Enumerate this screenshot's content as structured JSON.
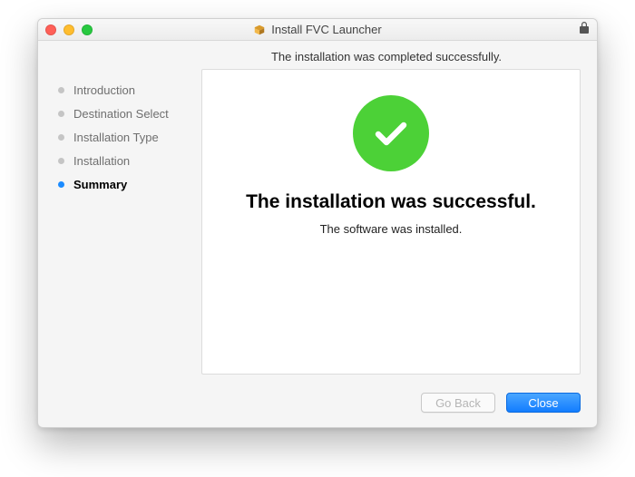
{
  "window": {
    "title": "Install FVC Launcher"
  },
  "subheader": "The installation was completed successfully.",
  "sidebar": {
    "steps": [
      {
        "label": "Introduction",
        "active": false
      },
      {
        "label": "Destination Select",
        "active": false
      },
      {
        "label": "Installation Type",
        "active": false
      },
      {
        "label": "Installation",
        "active": false
      },
      {
        "label": "Summary",
        "active": true
      }
    ]
  },
  "content": {
    "headline": "The installation was successful.",
    "subtext": "The software was installed."
  },
  "footer": {
    "back_label": "Go Back",
    "close_label": "Close"
  },
  "colors": {
    "success_badge": "#4cd137",
    "primary_button": "#127dff",
    "active_step_bullet": "#1b8bff"
  }
}
